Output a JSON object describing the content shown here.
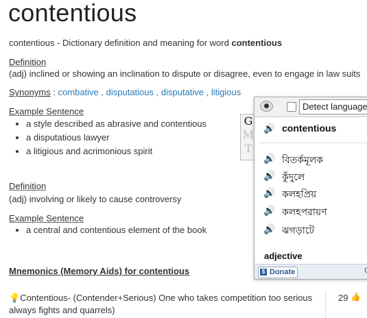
{
  "word": "contentious",
  "subtitle": {
    "prefix": "contentious - Dictionary definition and meaning for word ",
    "word": "contentious"
  },
  "definitions": [
    {
      "label": "Definition",
      "text": "(adj) inclined or showing an inclination to dispute or disagree, even to engage in law suits",
      "synonyms_label": "Synonyms",
      "synonyms": [
        "combative",
        "disputatious",
        "disputative",
        "litigious"
      ],
      "example_label": "Example Sentence",
      "examples": [
        "a style described as abrasive and contentious",
        "a disputatious lawyer",
        "a litigious and acrimonious spirit"
      ]
    },
    {
      "label": "Definition",
      "text": "(adj) involving or likely to cause controversy",
      "example_label": "Example Sentence",
      "examples": [
        "a central and contentious element of the book"
      ]
    }
  ],
  "mnemonics": {
    "title": "Mnemonics (Memory Aids) for contentious",
    "entry": "Contentious- (Contender+Serious) One who takes competition too serious always fights and quarrels)",
    "votes": "29"
  },
  "translate_popup": {
    "tab_letters": [
      "G",
      "M",
      "T"
    ],
    "language_select": "Detect language",
    "source_word": "contentious",
    "translations": [
      "বিতর্কমূলক",
      "কুঁদুলে",
      "কলহপ্রিয়",
      "কলহপরায়ণ",
      "ঝগড়াটে"
    ],
    "part_of_speech": "adjective",
    "donate_label": "Donate",
    "footer_char": "C"
  }
}
